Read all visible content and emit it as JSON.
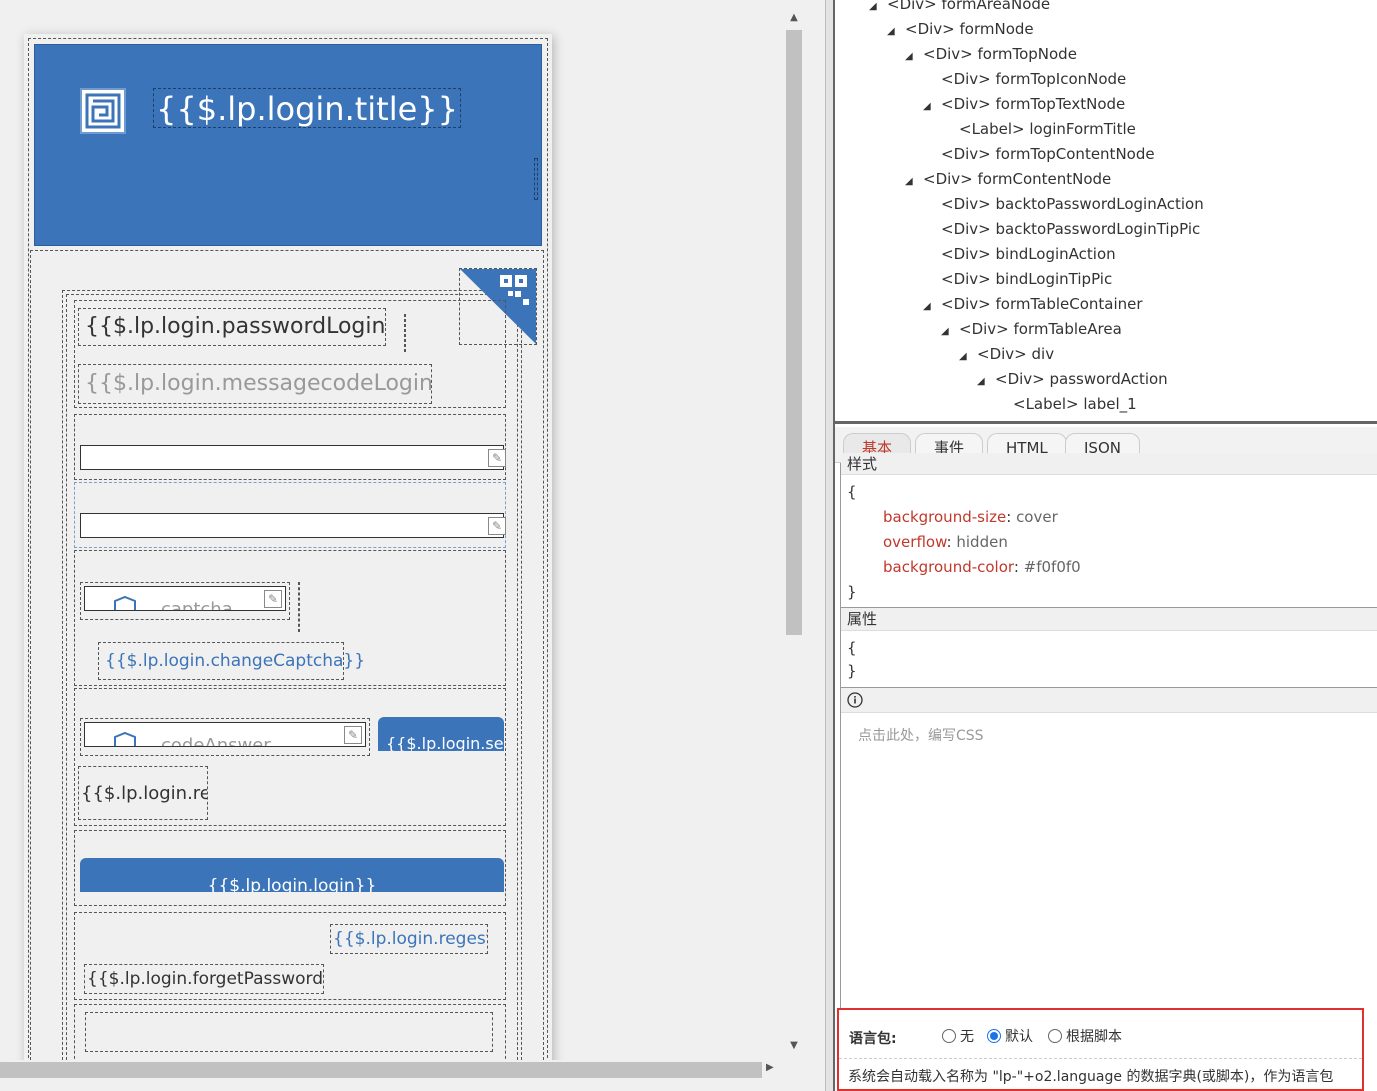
{
  "canvas": {
    "title_placeholder": "{{$.lp.login.title}}",
    "password_login": "{{$.lp.login.passwordLogin}}",
    "messagecode_login": "{{$.lp.login.messagecodeLogin}}",
    "captcha_placeholder": "captcha",
    "change_captcha": "{{$.lp.login.changeCaptcha}}",
    "code_answer_placeholder": "codeAnswer",
    "send_code": "{{$.lp.login.send",
    "resend": "{{$.lp.login.rese",
    "login_button": "{{$.lp.login.login}}",
    "regest": "{{$.lp.login.regest}}",
    "forget_password": "{{$.lp.login.forgetPassword}}"
  },
  "tree": {
    "items": [
      {
        "arrow": "◢",
        "text": "<Div> formAreaNode"
      },
      {
        "arrow": "◢",
        "text": "<Div> formNode"
      },
      {
        "arrow": "◢",
        "text": "<Div> formTopNode"
      },
      {
        "arrow": "",
        "text": "<Div> formTopIconNode"
      },
      {
        "arrow": "◢",
        "text": "<Div> formTopTextNode"
      },
      {
        "arrow": "",
        "text": "<Label> loginFormTitle"
      },
      {
        "arrow": "",
        "text": "<Div> formTopContentNode"
      },
      {
        "arrow": "◢",
        "text": "<Div> formContentNode"
      },
      {
        "arrow": "",
        "text": "<Div> backtoPasswordLoginAction"
      },
      {
        "arrow": "",
        "text": "<Div> backtoPasswordLoginTipPic"
      },
      {
        "arrow": "",
        "text": "<Div> bindLoginAction"
      },
      {
        "arrow": "",
        "text": "<Div> bindLoginTipPic"
      },
      {
        "arrow": "◢",
        "text": "<Div> formTableContainer"
      },
      {
        "arrow": "◢",
        "text": "<Div> formTableArea"
      },
      {
        "arrow": "◢",
        "text": "<Div> div"
      },
      {
        "arrow": "◢",
        "text": "<Div> passwordAction"
      },
      {
        "arrow": "",
        "text": "<Label> label_1"
      }
    ]
  },
  "tabs": [
    {
      "label": "基本"
    },
    {
      "label": "事件"
    },
    {
      "label": "HTML"
    },
    {
      "label": "JSON"
    }
  ],
  "style": {
    "section_partial": "样式",
    "open_brace": "{",
    "close_brace": "}",
    "props": [
      {
        "name": "background-size",
        "value": "cover"
      },
      {
        "name": "overflow",
        "value": "hidden"
      },
      {
        "name": "background-color",
        "value": "#f0f0f0"
      }
    ],
    "sep": ":",
    "attributes_head": "属性",
    "css_hint": "点击此处，编写CSS"
  },
  "language": {
    "label": "语言包:",
    "options": [
      {
        "label": "无",
        "selected": false
      },
      {
        "label": "默认",
        "selected": true
      },
      {
        "label": "根据脚本",
        "selected": false
      }
    ],
    "description": "系统会自动载入名称为 \"lp-\"+o2.language 的数据字典(或脚本)，作为语言包"
  },
  "colors": {
    "accent": "#3b74b8",
    "highlight_border": "#e03030",
    "property_name": "#c0392b"
  }
}
